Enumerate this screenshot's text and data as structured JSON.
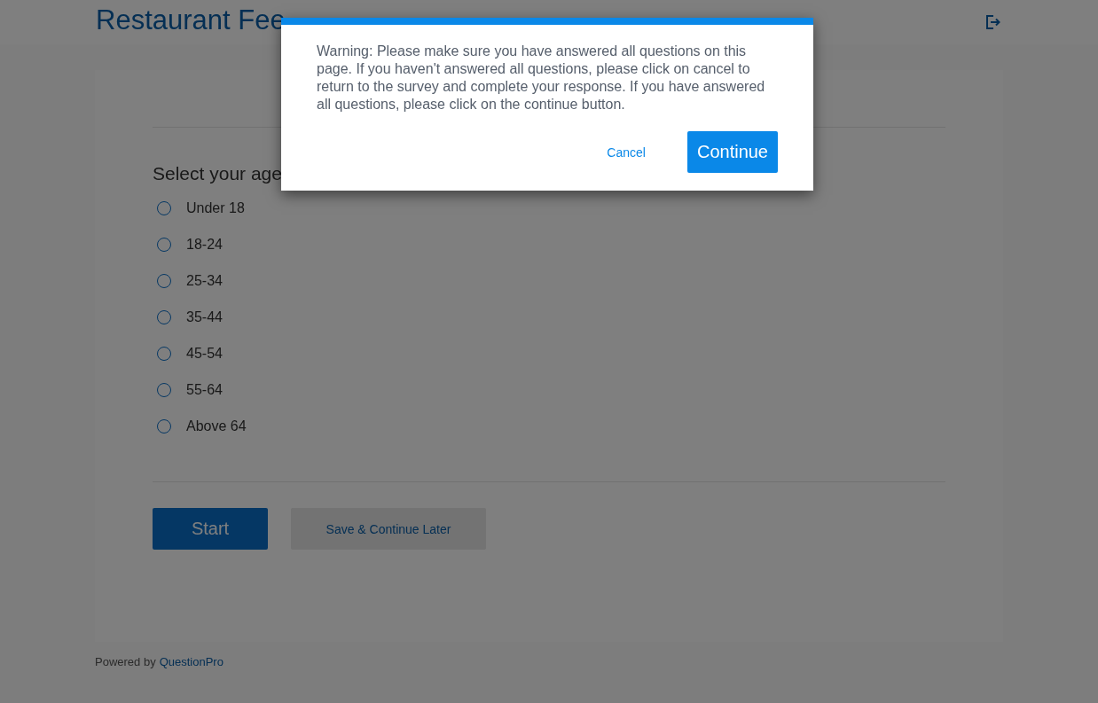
{
  "header": {
    "title": "Restaurant Fee"
  },
  "question": {
    "text": "Select your age",
    "options": [
      {
        "label": "Under 18",
        "selected": false
      },
      {
        "label": "18-24",
        "selected": false
      },
      {
        "label": "25-34",
        "selected": false
      },
      {
        "label": "35-44",
        "selected": false
      },
      {
        "label": "45-54",
        "selected": false
      },
      {
        "label": "55-64",
        "selected": false
      },
      {
        "label": "Above 64",
        "selected": false
      }
    ]
  },
  "buttons": {
    "start": "Start",
    "save": "Save & Continue Later"
  },
  "footer": {
    "prefix": "Powered by",
    "link": "QuestionPro"
  },
  "dialog": {
    "message": "Warning: Please make sure you have answered all questions on this page. If you haven't answered all questions, please click on cancel to return to the survey and complete your response. If you have answered all questions, please click on the continue button.",
    "cancel": "Cancel",
    "continue": "Continue"
  }
}
